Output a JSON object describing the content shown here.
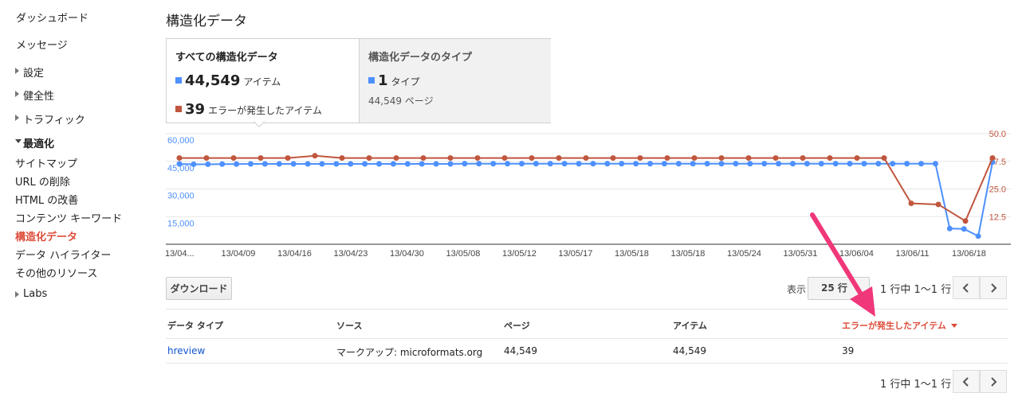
{
  "sidebar": {
    "items": [
      {
        "label": "ダッシュボード"
      },
      {
        "label": "メッセージ"
      },
      {
        "label": "設定"
      },
      {
        "label": "健全性"
      },
      {
        "label": "トラフィック"
      },
      {
        "label": "最適化"
      },
      {
        "label": "サイトマップ"
      },
      {
        "label": "URL の削除"
      },
      {
        "label": "HTML の改善"
      },
      {
        "label": "コンテンツ キーワード"
      },
      {
        "label": "構造化データ"
      },
      {
        "label": "データ ハイライター"
      },
      {
        "label": "その他のリソース"
      },
      {
        "label": "Labs"
      }
    ]
  },
  "page": {
    "title": "構造化データ"
  },
  "summary": {
    "all": {
      "title": "すべての構造化データ",
      "items_value": "44,549",
      "items_unit": "アイテム",
      "errors_value": "39",
      "errors_unit": "エラーが発生したアイテム"
    },
    "types": {
      "title": "構造化データのタイプ",
      "types_value": "1",
      "types_unit": "タイプ",
      "pages_text": "44,549 ページ"
    }
  },
  "colors": {
    "items": "#4d90fe",
    "errors": "#c0563d",
    "accent": "#dd4b39",
    "link": "#15c"
  },
  "chart_data": {
    "type": "line",
    "x": [
      "13/04...",
      "13/04/09",
      "13/04/16",
      "13/04/23",
      "13/04/30",
      "13/05/08",
      "13/05/12",
      "13/05/17",
      "13/05/18",
      "13/05/18",
      "13/05/24",
      "13/05/31",
      "13/06/04",
      "13/06/11",
      "13/06/18"
    ],
    "left_axis": {
      "ticks": [
        "60,000",
        "45,000",
        "30,000",
        "15,000"
      ],
      "ylim": [
        0,
        60000
      ]
    },
    "right_axis": {
      "ticks": [
        "50.0",
        "37.5",
        "25.0",
        "12.5"
      ],
      "ylim": [
        0,
        50
      ]
    },
    "grid": true,
    "series": [
      {
        "axis": "left",
        "color": "#4d90fe",
        "values": [
          43600,
          43400,
          43400,
          43500,
          43500,
          43600,
          43600,
          43600,
          43600,
          43600,
          43600,
          43600,
          43600,
          43600,
          43600,
          43600,
          43600,
          43600,
          43600,
          43600,
          43700,
          43700,
          43700,
          43700,
          43700,
          43700,
          43700,
          43700,
          43700,
          43700,
          43700,
          43700,
          43700,
          43700,
          43700,
          43700,
          43700,
          43700,
          43700,
          43700,
          43700,
          43700,
          43700,
          43700,
          43700,
          43700,
          43700,
          43700,
          43700,
          43700,
          43700,
          43700,
          43700,
          43700,
          8500,
          8300,
          4400,
          44549
        ]
      },
      {
        "axis": "right",
        "color": "#c0563d",
        "values": [
          39,
          39,
          39,
          39,
          39,
          40,
          39,
          39,
          39,
          39,
          39,
          39,
          39,
          39,
          39,
          39,
          39,
          39,
          39,
          39,
          39,
          39,
          39,
          39,
          39,
          39,
          39,
          18.5,
          18,
          10.5,
          39
        ]
      }
    ]
  },
  "toolbar": {
    "download_label": "ダウンロード",
    "show_label": "表示",
    "rows_value": "25 行",
    "pager_text": "1 行中 1〜1 行"
  },
  "table": {
    "headers": [
      "データ タイプ",
      "ソース",
      "ページ",
      "アイテム",
      "エラーが発生したアイテム"
    ],
    "rows": [
      [
        "hreview",
        "マークアップ: microformats.org",
        "44,549",
        "44,549",
        "39"
      ]
    ]
  },
  "footer": {
    "pager_text": "1 行中 1〜1 行"
  }
}
